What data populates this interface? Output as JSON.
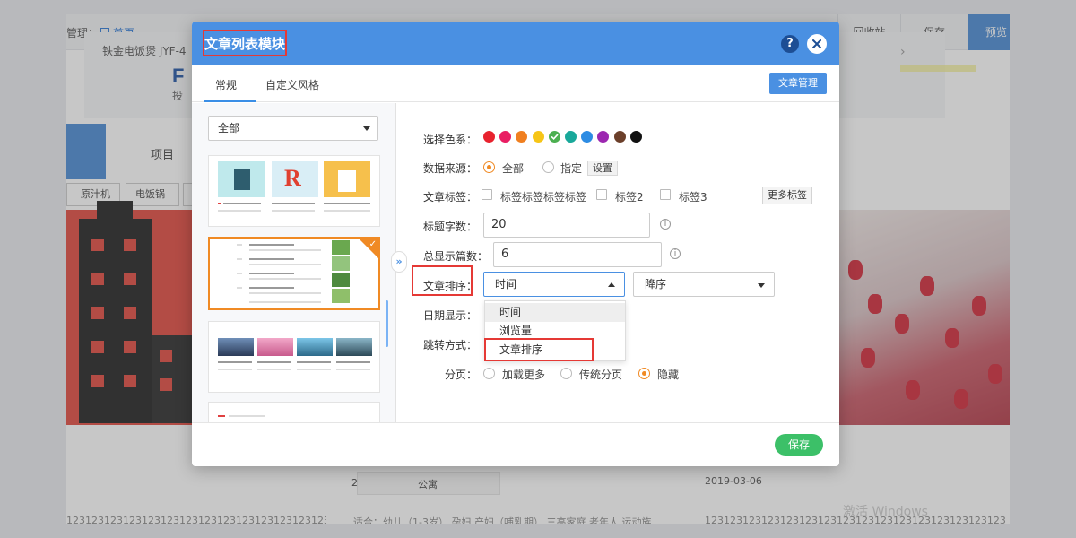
{
  "background": {
    "breadcrumb_label": "管理：",
    "breadcrumb_home": "首页",
    "recycle": "回收站",
    "save": "保存",
    "preview": "预览",
    "company_text": "铁金电饭煲 JYF-4",
    "brand": "F",
    "brand_sub": "投",
    "nav_item": "项目",
    "categories": [
      "原汁机",
      "电饭锅",
      ""
    ],
    "bottom_left": "123123123123123123123123123123123123123123123123",
    "bottom_mid_title": "公寓",
    "bottom_mid_text": "适合：幼儿（1-3岁） 孕妇 产妇（哺乳期） 三高家庭 老年人 运动族",
    "bottom_date": "2019-03-06",
    "bottom_right": "123123123123123123123123123123123123123123123123",
    "watermark": "激活 Windows",
    "prefix_num": "2"
  },
  "modal": {
    "title": "文章列表模块",
    "help": "?",
    "tabs": [
      "常规",
      "自定义风格"
    ],
    "article_manage": "文章管理",
    "filter": "全部",
    "expand": "»",
    "colors_label": "选择色系：",
    "colors": [
      "#e8222e",
      "#e91e63",
      "#f07f1f",
      "#f6c517",
      "#4caf50",
      "#19a89a",
      "#2d8ce3",
      "#9c27b0",
      "#6b3f2a",
      "#111111"
    ],
    "selected_color_index": 4,
    "source_label": "数据来源：",
    "source_all": "全部",
    "source_specified": "指定",
    "source_set": "设置",
    "tags_label": "文章标签：",
    "tags": [
      "标签标签标签标签",
      "标签2",
      "标签3"
    ],
    "more_tags": "更多标签",
    "title_len_label": "标题字数：",
    "title_len": "20",
    "total_label": "总显示篇数：",
    "total": "6",
    "sort_label": "文章排序：",
    "sort_value": "时间",
    "sort_options": [
      "时间",
      "浏览量",
      "文章排序"
    ],
    "order_value": "降序",
    "date_label": "日期显示：",
    "jump_label": "跳转方式：",
    "paging_label": "分页：",
    "paging_options": [
      "加载更多",
      "传统分页",
      "隐藏"
    ],
    "save": "保存"
  }
}
